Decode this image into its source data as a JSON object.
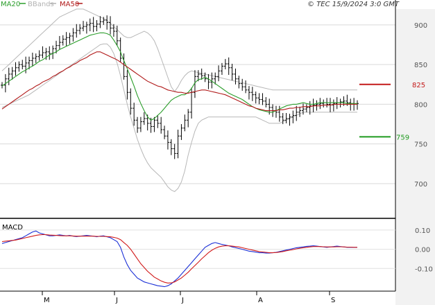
{
  "legend": {
    "ma20": {
      "label": "MA20",
      "color": "#2a9d2a"
    },
    "bbands": {
      "label": "BBands",
      "color": "#b3b3b3"
    },
    "ma50": {
      "label": "MA50",
      "color": "#b01818"
    }
  },
  "credit": "© TEC 15/9/2024 3:0 GMT",
  "macd_label": "MACD",
  "chart_data": [
    {
      "type": "candlestick",
      "price_axis": {
        "ticks": [
          700,
          750,
          800,
          850,
          900
        ],
        "ylim": [
          665,
          920
        ]
      },
      "x_ticks": [
        "M",
        "J",
        "J",
        "A",
        "S"
      ],
      "levels": [
        {
          "label": "825",
          "value": 825,
          "color": "#c41a1a"
        },
        {
          "label": "759",
          "value": 759,
          "color": "#1f9a1f"
        }
      ],
      "grid": true,
      "series": {
        "close": [
          824,
          832,
          838,
          842,
          846,
          850,
          848,
          852,
          855,
          858,
          860,
          862,
          865,
          866,
          864,
          870,
          874,
          878,
          882,
          884,
          886,
          890,
          893,
          896,
          898,
          900,
          902,
          898,
          901,
          904,
          906,
          903,
          896,
          892,
          880,
          858,
          835,
          815,
          795,
          780,
          770,
          778,
          782,
          776,
          772,
          780,
          776,
          768,
          760,
          752,
          744,
          738,
          760,
          770,
          780,
          790,
          815,
          835,
          838,
          836,
          832,
          828,
          832,
          835,
          842,
          848,
          851,
          846,
          838,
          832,
          826,
          822,
          818,
          815,
          812,
          808,
          806,
          804,
          800,
          796,
          792,
          790,
          784,
          780,
          782,
          784,
          786,
          790,
          792,
          794,
          796,
          798,
          799,
          800,
          801,
          802,
          800,
          799,
          801,
          802,
          803,
          804,
          802,
          801,
          800,
          801
        ],
        "ma20": [
          823,
          826,
          829,
          832,
          835,
          838,
          841,
          843,
          846,
          848,
          851,
          854,
          856,
          859,
          862,
          864,
          866,
          869,
          871,
          873,
          875,
          877,
          879,
          881,
          883,
          885,
          887,
          888,
          889,
          890,
          890,
          889,
          887,
          881,
          874,
          866,
          855,
          845,
          834,
          823,
          811,
          801,
          792,
          784,
          780,
          782,
          786,
          790,
          795,
          800,
          805,
          808,
          810,
          812,
          812,
          815,
          820,
          827,
          831,
          832,
          834,
          832,
          829,
          826,
          823,
          820,
          817,
          814,
          812,
          810,
          808,
          806,
          803,
          800,
          797,
          795,
          793,
          792,
          791,
          790,
          790,
          792,
          794,
          796,
          798,
          799,
          800,
          800,
          801,
          802,
          801,
          800,
          800,
          801,
          802,
          802,
          802,
          802,
          802,
          802,
          802,
          802,
          801,
          801,
          801,
          801
        ],
        "ma50": [
          794,
          797,
          800,
          803,
          806,
          809,
          812,
          815,
          818,
          820,
          823,
          825,
          828,
          830,
          832,
          835,
          837,
          840,
          842,
          845,
          847,
          850,
          852,
          855,
          857,
          859,
          862,
          864,
          866,
          866,
          864,
          862,
          860,
          858,
          856,
          853,
          850,
          847,
          844,
          841,
          838,
          835,
          832,
          829,
          827,
          825,
          823,
          822,
          820,
          818,
          817,
          816,
          815,
          815,
          814,
          814,
          815,
          816,
          817,
          818,
          818,
          817,
          816,
          815,
          814,
          813,
          812,
          810,
          808,
          806,
          804,
          802,
          800,
          798,
          797,
          795,
          794,
          793,
          792,
          792,
          792,
          792,
          793,
          793,
          794,
          795,
          795,
          796,
          796,
          797,
          797,
          797,
          798,
          798,
          798,
          799,
          799,
          799,
          800,
          800,
          800,
          800,
          800,
          800,
          800,
          800
        ],
        "bb_upper": [
          842,
          846,
          850,
          854,
          858,
          862,
          866,
          870,
          874,
          878,
          882,
          886,
          890,
          894,
          898,
          902,
          906,
          910,
          912,
          914,
          916,
          918,
          920,
          920,
          920,
          918,
          916,
          914,
          912,
          910,
          908,
          906,
          902,
          898,
          894,
          890,
          886,
          884,
          884,
          886,
          888,
          890,
          892,
          890,
          886,
          880,
          870,
          858,
          846,
          834,
          822,
          816,
          822,
          830,
          836,
          840,
          842,
          841,
          840,
          839,
          838,
          837,
          836,
          835,
          834,
          833,
          832,
          831,
          830,
          829,
          828,
          827,
          826,
          825,
          824,
          823,
          822,
          821,
          820,
          819,
          818,
          818,
          818,
          818,
          818,
          818,
          818,
          818,
          818,
          818,
          818,
          818,
          818,
          818,
          818,
          818,
          818,
          818,
          818,
          818,
          818,
          818,
          818,
          818,
          818,
          818
        ],
        "bb_lower": [
          796,
          798,
          800,
          802,
          804,
          806,
          808,
          810,
          812,
          815,
          818,
          821,
          824,
          827,
          830,
          833,
          836,
          839,
          842,
          845,
          848,
          851,
          854,
          857,
          860,
          863,
          866,
          869,
          872,
          875,
          876,
          876,
          872,
          864,
          852,
          836,
          818,
          800,
          784,
          770,
          756,
          744,
          734,
          726,
          720,
          716,
          712,
          708,
          702,
          696,
          692,
          690,
          694,
          702,
          716,
          736,
          752,
          766,
          776,
          780,
          782,
          784,
          784,
          784,
          784,
          784,
          784,
          784,
          784,
          784,
          784,
          784,
          784,
          784,
          784,
          784,
          782,
          780,
          778,
          776,
          776,
          776,
          776,
          778,
          780,
          782,
          784,
          786,
          788,
          790,
          790,
          790,
          790,
          790,
          790,
          790,
          790,
          790,
          790,
          790,
          790,
          790,
          790,
          790,
          790,
          790
        ]
      }
    },
    {
      "type": "line",
      "name": "macd",
      "y_ticks": [
        0.1,
        0.0,
        -0.1
      ],
      "tick_labels": [
        "0.10",
        "0.00",
        "-0.10"
      ],
      "ylim": [
        -0.2,
        0.15
      ],
      "series": {
        "macd": [
          0.03,
          0.035,
          0.04,
          0.045,
          0.05,
          0.055,
          0.06,
          0.07,
          0.08,
          0.09,
          0.095,
          0.085,
          0.08,
          0.075,
          0.07,
          0.07,
          0.072,
          0.075,
          0.072,
          0.07,
          0.072,
          0.068,
          0.066,
          0.068,
          0.07,
          0.072,
          0.07,
          0.068,
          0.065,
          0.068,
          0.07,
          0.065,
          0.06,
          0.05,
          0.04,
          0.01,
          -0.04,
          -0.08,
          -0.11,
          -0.13,
          -0.15,
          -0.16,
          -0.17,
          -0.175,
          -0.18,
          -0.185,
          -0.19,
          -0.192,
          -0.195,
          -0.19,
          -0.18,
          -0.165,
          -0.15,
          -0.13,
          -0.11,
          -0.09,
          -0.07,
          -0.05,
          -0.03,
          -0.01,
          0.01,
          0.02,
          0.03,
          0.035,
          0.03,
          0.025,
          0.022,
          0.018,
          0.012,
          0.008,
          0.004,
          0.0,
          -0.005,
          -0.01,
          -0.012,
          -0.015,
          -0.018,
          -0.018,
          -0.02,
          -0.02,
          -0.018,
          -0.016,
          -0.012,
          -0.008,
          -0.004,
          0.0,
          0.004,
          0.008,
          0.01,
          0.012,
          0.015,
          0.016,
          0.018,
          0.016,
          0.014,
          0.012,
          0.01,
          0.012,
          0.014,
          0.016,
          0.014,
          0.012,
          0.01,
          0.01,
          0.01,
          0.01
        ],
        "signal": [
          0.04,
          0.042,
          0.044,
          0.046,
          0.048,
          0.052,
          0.056,
          0.06,
          0.064,
          0.068,
          0.072,
          0.075,
          0.076,
          0.076,
          0.074,
          0.073,
          0.072,
          0.071,
          0.07,
          0.07,
          0.07,
          0.069,
          0.068,
          0.068,
          0.068,
          0.068,
          0.068,
          0.068,
          0.067,
          0.067,
          0.067,
          0.066,
          0.065,
          0.062,
          0.058,
          0.05,
          0.035,
          0.02,
          0.0,
          -0.025,
          -0.05,
          -0.075,
          -0.095,
          -0.115,
          -0.13,
          -0.145,
          -0.155,
          -0.165,
          -0.172,
          -0.176,
          -0.175,
          -0.17,
          -0.16,
          -0.15,
          -0.135,
          -0.12,
          -0.102,
          -0.085,
          -0.068,
          -0.05,
          -0.034,
          -0.018,
          -0.005,
          0.005,
          0.012,
          0.016,
          0.018,
          0.018,
          0.016,
          0.014,
          0.012,
          0.008,
          0.004,
          0.0,
          -0.004,
          -0.008,
          -0.012,
          -0.014,
          -0.016,
          -0.018,
          -0.018,
          -0.017,
          -0.015,
          -0.012,
          -0.008,
          -0.005,
          -0.002,
          0.002,
          0.005,
          0.008,
          0.01,
          0.012,
          0.014,
          0.014,
          0.014,
          0.013,
          0.012,
          0.012,
          0.012,
          0.013,
          0.013,
          0.012,
          0.011,
          0.011,
          0.01,
          0.01
        ]
      }
    }
  ]
}
